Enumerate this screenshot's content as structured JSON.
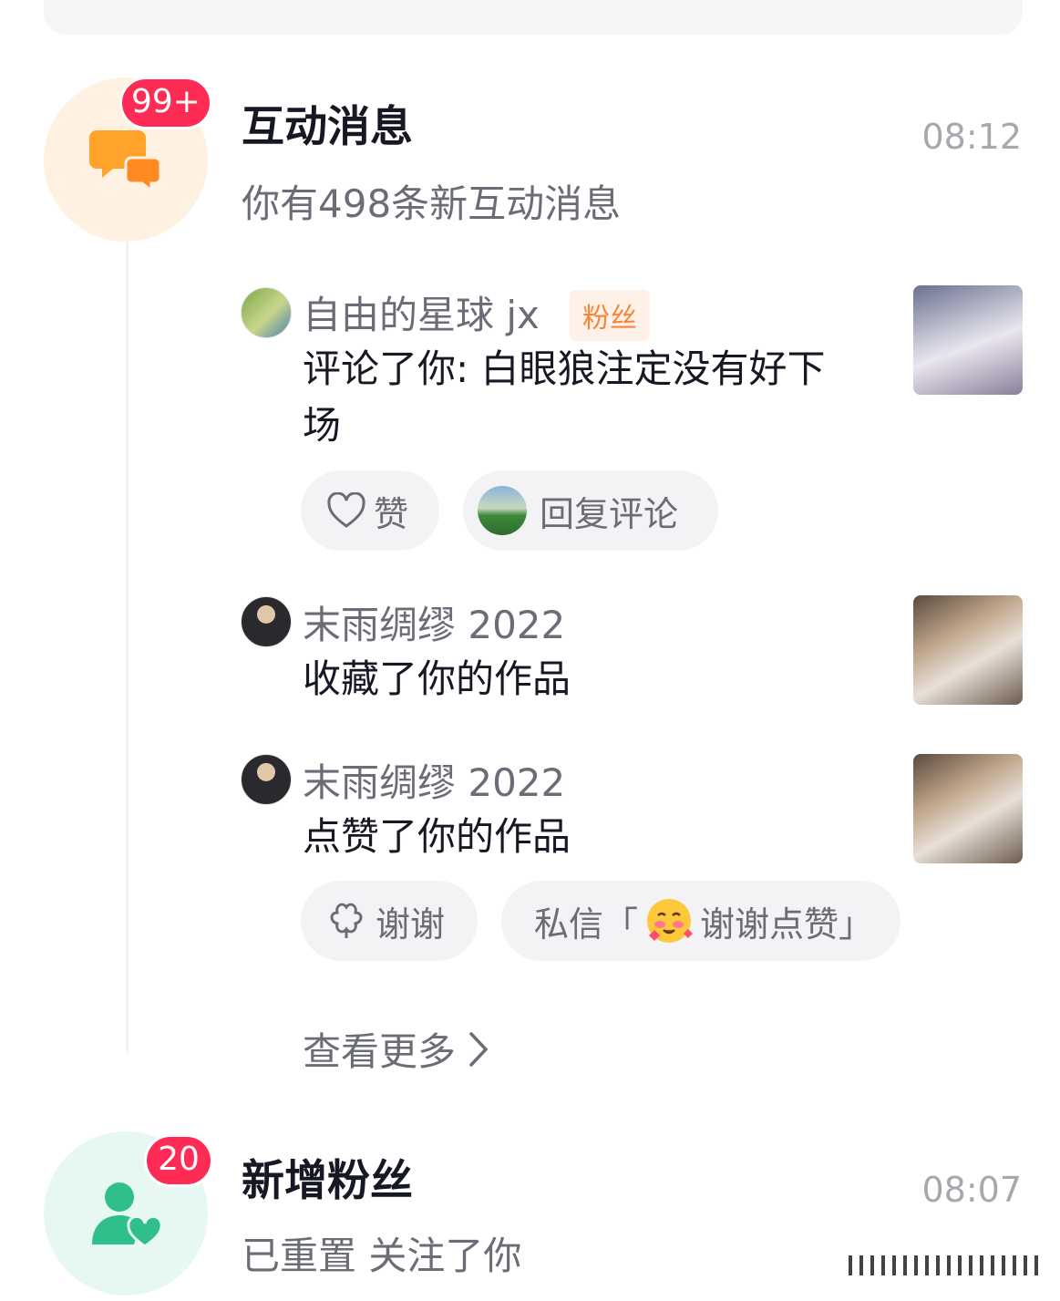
{
  "interactions": {
    "title": "互动消息",
    "time": "08:12",
    "summary": "你有498条新互动消息",
    "badge": "99+",
    "items": [
      {
        "user": "自由的星球 jx",
        "tag": "粉丝",
        "action": "评论了你: 白眼狼注定没有好下场",
        "buttons": {
          "like": "赞",
          "reply": "回复评论"
        }
      },
      {
        "user": "末雨绸缪 2022",
        "action": "收藏了你的作品"
      },
      {
        "user": "末雨绸缪 2022",
        "action": "点赞了你的作品",
        "buttons": {
          "thanks": "谢谢",
          "dm_prefix": "私信「",
          "dm_text": "谢谢点赞」"
        }
      }
    ],
    "see_more": "查看更多"
  },
  "followers": {
    "title": "新增粉丝",
    "time": "08:07",
    "summary": "已重置 关注了你",
    "badge": "20"
  },
  "colors": {
    "badge": "#fe2c55",
    "interaction_icon_bg": "#fff1e2",
    "interaction_icon": "#ffa32b",
    "follower_icon_bg": "#e6f8f1",
    "follower_icon": "#2fbf8a",
    "fan_tag": "#f5873a"
  },
  "icons": [
    "chat-bubbles-icon",
    "heart-outline-icon",
    "flower-icon",
    "chevron-right-icon",
    "user-heart-icon"
  ]
}
